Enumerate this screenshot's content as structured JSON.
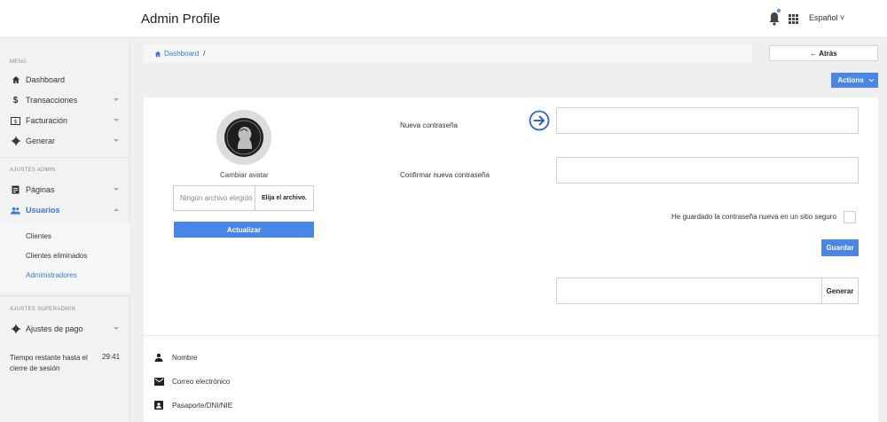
{
  "header": {
    "title": "Admin Profile",
    "language": "Español"
  },
  "sidebar": {
    "section_menu": "MENÚ",
    "section_admin": "AJUSTES ADMIN",
    "section_superadmin": "AJUSTES SUPERADMIN",
    "items": [
      {
        "label": "Dashboard",
        "icon": "home-icon"
      },
      {
        "label": "Transacciones",
        "icon": "dollar-icon"
      },
      {
        "label": "Facturación",
        "icon": "invoice-icon"
      },
      {
        "label": "Generar",
        "icon": "gear-icon"
      },
      {
        "label": "Páginas",
        "icon": "page-icon"
      },
      {
        "label": "Usuarios",
        "icon": "users-icon"
      },
      {
        "label": "Ajustes de pago",
        "icon": "gear-icon"
      }
    ],
    "subitems": [
      "Clientes",
      "Clientes eliminados",
      "Administradores"
    ],
    "session_label": "Tiempo restante hasta el cierre de sesión",
    "session_time": "29:41"
  },
  "breadcrumb": {
    "home": "Dashboard",
    "sep": "/"
  },
  "buttons": {
    "back": "← Atrás",
    "actions": "Actions",
    "update": "Actualizar",
    "save": "Guardar",
    "generate": "Generar"
  },
  "avatar": {
    "label": "Cambiar avatar",
    "file_placeholder": "Ningún archivo elegido",
    "choose": "Elija el archivo."
  },
  "password": {
    "new_label": "Nueva contraseña",
    "confirm_label": "Confirmar nueva contraseña",
    "saved_check_label": "He guardado la contraseña nueva en un sitio seguro"
  },
  "info": {
    "name": "Nombre",
    "email": "Correo electrónico",
    "id": "Pasaporte/DNI/NIE"
  },
  "colors": {
    "accent": "#4a86e8",
    "link": "#3b77d8"
  }
}
